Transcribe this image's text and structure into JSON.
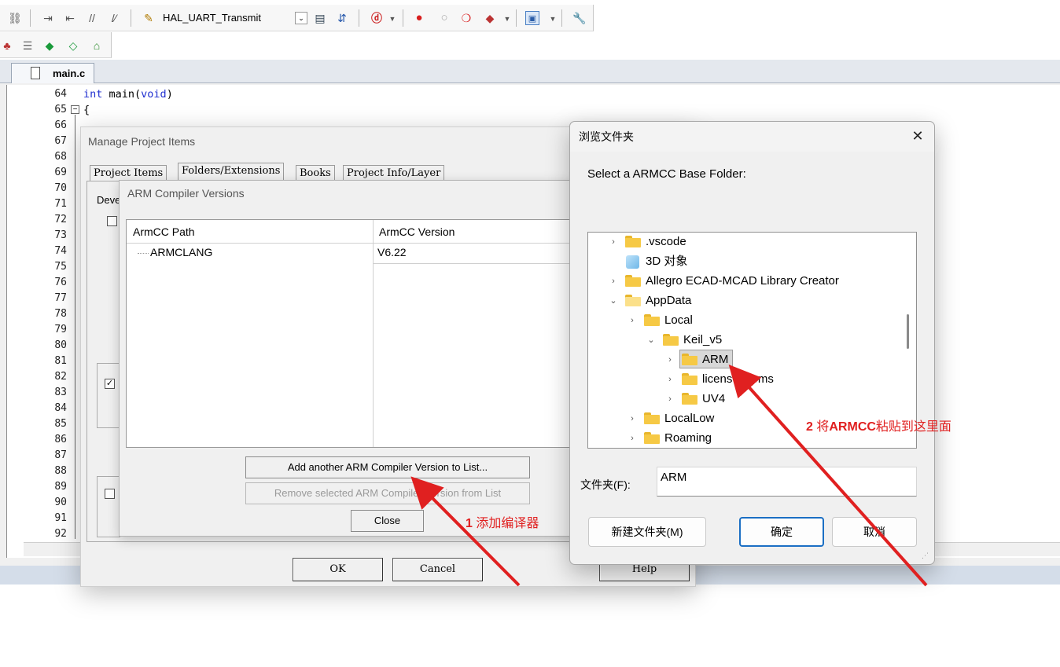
{
  "toolbar": {
    "target_name": "HAL_UART_Transmit",
    "icons_row1": [
      "debug-icon",
      "indent-icon",
      "unindent-icon",
      "comment-icon",
      "uncomment-icon",
      "target-options-icon",
      "browse-icon",
      "find-icon",
      "dropdown-icon",
      "breakpoint-icon",
      "breakpoint-disable-icon",
      "kill-breakpoints-icon",
      "debug-start-icon",
      "window-layout-icon",
      "settings-icon"
    ],
    "icons_row2": [
      "project-icon",
      "books-icon",
      "rte-icon",
      "pack-installer-icon",
      "manage-icon"
    ]
  },
  "editor": {
    "tab_label": "main.c",
    "line_numbers": [
      "64",
      "65",
      "66",
      "67",
      "68",
      "69",
      "70",
      "71",
      "72",
      "73",
      "74",
      "75",
      "76",
      "77",
      "78",
      "79",
      "80",
      "81",
      "82",
      "83",
      "84",
      "85",
      "86",
      "87",
      "88",
      "89",
      "90",
      "91",
      "92"
    ],
    "code_line_64_kw1": "int",
    "code_line_64_mid": " main(",
    "code_line_64_kw2": "void",
    "code_line_64_end": ")",
    "code_line_65": "{"
  },
  "manage_dialog": {
    "title": "Manage Project Items",
    "tabs": [
      "Project Items",
      "Folders/Extensions",
      "Books",
      "Project Info/Layer"
    ],
    "panel_label": "Deve",
    "buttons": {
      "ok": "OK",
      "cancel": "Cancel",
      "help": "Help"
    }
  },
  "arm_dialog": {
    "title": "ARM Compiler Versions",
    "columns": [
      "ArmCC Path",
      "ArmCC Version"
    ],
    "rows": [
      {
        "path": "ARMCLANG",
        "version": "V6.22"
      }
    ],
    "buttons": {
      "add": "Add another ARM Compiler Version to List...",
      "remove": "Remove selected ARM Compiler Version from List",
      "close": "Close"
    }
  },
  "browse_dialog": {
    "title": "浏览文件夹",
    "prompt": "Select a ARMCC Base Folder:",
    "tree": [
      {
        "label": ".vscode",
        "level": 0,
        "arrow": "›",
        "kind": "folder"
      },
      {
        "label": "3D 对象",
        "level": 0,
        "arrow": "",
        "kind": "cube"
      },
      {
        "label": "Allegro ECAD-MCAD Library Creator",
        "level": 0,
        "arrow": "›",
        "kind": "folder"
      },
      {
        "label": "AppData",
        "level": 0,
        "arrow": "⌄",
        "kind": "folder-open"
      },
      {
        "label": "Local",
        "level": 1,
        "arrow": "›",
        "kind": "folder"
      },
      {
        "label": "Keil_v5",
        "level": 2,
        "arrow": "⌄",
        "kind": "folder"
      },
      {
        "label": "ARM",
        "level": 3,
        "arrow": "›",
        "kind": "folder",
        "selected": true
      },
      {
        "label": "licens…terms",
        "level": 3,
        "arrow": "›",
        "kind": "folder"
      },
      {
        "label": "UV4",
        "level": 3,
        "arrow": "›",
        "kind": "folder"
      },
      {
        "label": "LocalLow",
        "level": 1,
        "arrow": "›",
        "kind": "folder"
      },
      {
        "label": "Roaming",
        "level": 1,
        "arrow": "›",
        "kind": "folder"
      }
    ],
    "folder_label": "文件夹(F):",
    "folder_value": "ARM",
    "buttons": {
      "new_folder": "新建文件夹(M)",
      "ok": "确定",
      "cancel": "取消"
    }
  },
  "annotations": {
    "step1_num": "1",
    "step1_text": "添加编译器",
    "step2_num": "2",
    "step2_pre": "将",
    "step2_bold": "ARMCC",
    "step2_post": "粘贴到这里面",
    "color": "#e02020"
  }
}
